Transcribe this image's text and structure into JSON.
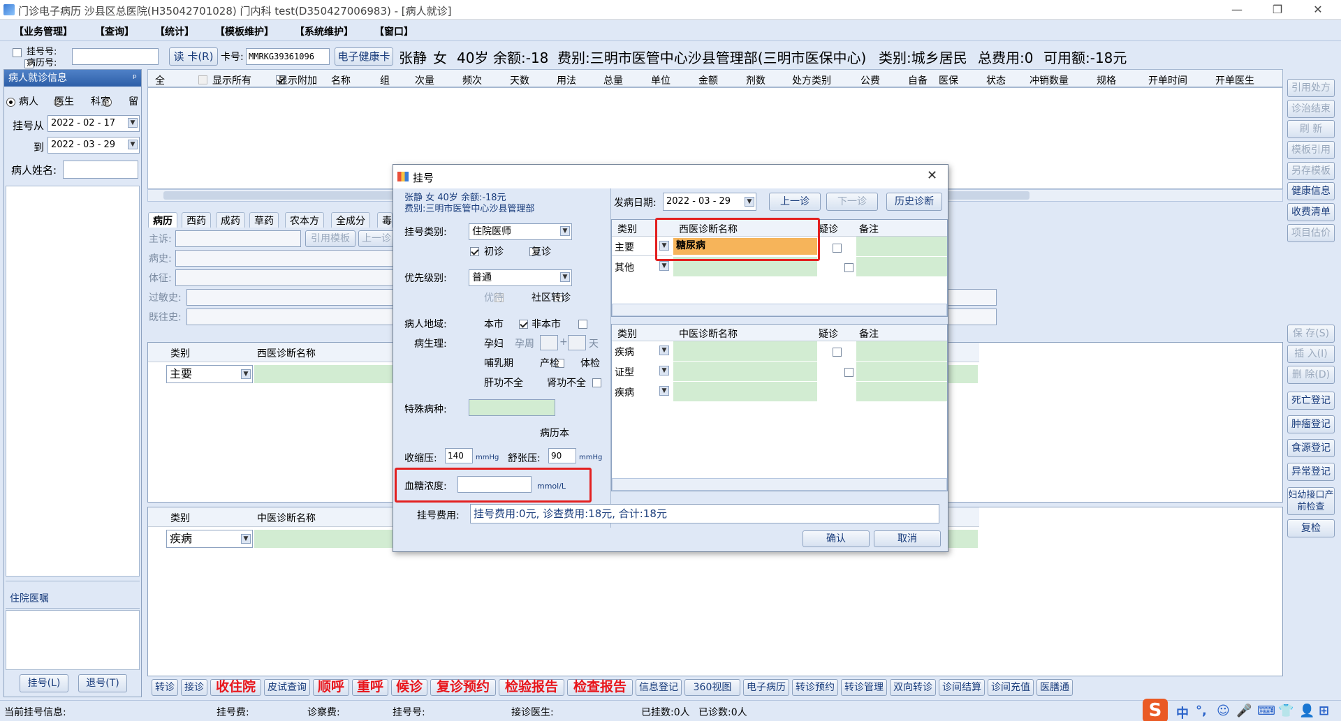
{
  "window": {
    "title": "门诊电子病历 沙县区总医院(H35042701028) 门内科 test(D350427006983) - [病人就诊]",
    "minimize": "—",
    "restore": "❐",
    "close": "✕"
  },
  "menu": [
    "【业务管理】",
    "【查询】",
    "【统计】",
    "【模板维护】",
    "【系统维护】",
    "【窗口】"
  ],
  "infobar": {
    "reg_no_label": "挂号号:",
    "record_no_label": "病历号:",
    "read_card": "读 卡(R)",
    "card_label": "卡号:",
    "card_value": "MMRKG39361096",
    "ehealth_card": "电子健康卡",
    "patient_name": "张静",
    "sex": "女",
    "age": "40岁",
    "balance": "余额:-18",
    "fee_type": "费别:三明市医管中心沙县管理部(三明市医保中心)",
    "category": "类别:城乡居民",
    "total_fee": "总费用:0",
    "available": "可用额:-18元"
  },
  "left": {
    "header": "病人就诊信息",
    "pin": "ᵖ",
    "radios": [
      "病人",
      "医生",
      "科室",
      "留"
    ],
    "from_label": "挂号从",
    "from_date": "2022 - 02 - 17",
    "to_label": "到",
    "to_date": "2022 - 03 - 29",
    "name_label": "病人姓名:",
    "inpatient_orders": "住院医嘱",
    "register_btn": "挂号(L)",
    "unregister_btn": "退号(T)"
  },
  "grid": {
    "all_label": "全",
    "show_all": "显示所有",
    "show_extra": "显示附加",
    "columns": [
      "名称",
      "组",
      "次量",
      "频次",
      "天数",
      "用法",
      "总量",
      "单位",
      "金额",
      "剂数",
      "处方类别",
      "公费",
      "自备",
      "医保",
      "状态",
      "冲销数量",
      "规格",
      "开单时间",
      "开单医生"
    ]
  },
  "tabs": [
    "病历",
    "西药",
    "成药",
    "草药",
    "农本方",
    "全成分",
    "毒"
  ],
  "emr": {
    "fields": [
      "主诉:",
      "病史:",
      "体征:",
      "过敏史:",
      "既往史:"
    ],
    "cite_template": "引用模板",
    "prev_visit": "上一诊",
    "western_header": {
      "type": "类别",
      "name": "西医诊断名称"
    },
    "western_row_type": "主要",
    "tcm_header": {
      "type": "类别",
      "name": "中医诊断名称"
    },
    "tcm_row_type": "疾病"
  },
  "right_buttons": [
    "引用处方",
    "诊治结束",
    "刷 新",
    "模板引用",
    "另存模板",
    "健康信息",
    "收费清单",
    "项目估价",
    "保 存(S)",
    "插 入(I)",
    "删 除(D)",
    "死亡登记",
    "肿瘤登记",
    "食源登记",
    "异常登记",
    "妇幼接口产前检查",
    "复检"
  ],
  "right_buttons_enabled": [
    false,
    false,
    false,
    false,
    false,
    true,
    true,
    false,
    false,
    false,
    false,
    true,
    true,
    true,
    true,
    true,
    true
  ],
  "bottom_buttons": [
    {
      "label": "转诊",
      "red": false
    },
    {
      "label": "接诊",
      "red": false
    },
    {
      "label": "收住院",
      "red": true
    },
    {
      "label": "皮试查询",
      "red": false
    },
    {
      "label": "顺呼",
      "red": true
    },
    {
      "label": "重呼",
      "red": true
    },
    {
      "label": "候诊",
      "red": true
    },
    {
      "label": "复诊预约",
      "red": true
    },
    {
      "label": "检验报告",
      "red": true
    },
    {
      "label": "检查报告",
      "red": true
    },
    {
      "label": "信息登记",
      "red": false
    },
    {
      "label": "360视图",
      "red": false
    },
    {
      "label": "电子病历",
      "red": false
    },
    {
      "label": "转诊预约",
      "red": false
    },
    {
      "label": "转诊管理",
      "red": false
    },
    {
      "label": "双向转诊",
      "red": false
    },
    {
      "label": "诊间结算",
      "red": false
    },
    {
      "label": "诊间充值",
      "red": false
    },
    {
      "label": "医膳通",
      "red": false
    }
  ],
  "status": {
    "current": "当前挂号信息:",
    "reg_fee": "挂号费:",
    "diag_fee": "诊察费:",
    "reg_no": "挂号号:",
    "doctor": "接诊医生:",
    "registered": "已挂数:0人",
    "seen": "已诊数:0人"
  },
  "ime": {
    "logo": "S",
    "items": [
      "中",
      "°,",
      "☺",
      "🎤",
      "⌨",
      "👕",
      "👤",
      "⊞"
    ]
  },
  "dialog": {
    "title": "挂号",
    "close": "✕",
    "patient_line1": "张静 女 40岁 余额:-18元",
    "patient_line2": "费别:三明市医管中心沙县管理部",
    "reg_type_label": "挂号类别:",
    "reg_type": "住院医师",
    "first_visit": "初诊",
    "revisit": "复诊",
    "priority_label": "优先级别:",
    "priority": "普通",
    "preferential": "优待",
    "community_transfer": "社区转诊",
    "region_label": "病人地域:",
    "local": "本市",
    "nonlocal": "非本市",
    "physio_label": "病生理:",
    "pregnant": "孕妇",
    "preg_weeks": "孕周",
    "plus": "+",
    "days": "天",
    "lactation": "哺乳期",
    "prenatal": "产检",
    "checkup": "体检",
    "liver": "肝功不全",
    "kidney": "肾功不全",
    "special_label": "特殊病种:",
    "record_book": "病历本",
    "systolic_label": "收缩压:",
    "systolic": "140",
    "diastolic_label": "舒张压:",
    "diastolic": "90",
    "mmhg": "mmHg",
    "glucose_label": "血糖浓度:",
    "glucose_unit": "mmol/L",
    "onset_label": "发病日期:",
    "onset_date": "2022 - 03 - 29",
    "prev_btn": "上一诊",
    "next_btn": "下一诊",
    "history_btn": "历史诊断",
    "western_cols": [
      "类别",
      "西医诊断名称",
      "疑诊",
      "备注"
    ],
    "western_rows": [
      {
        "type": "主要",
        "name": "糖尿病"
      },
      {
        "type": "其他",
        "name": ""
      }
    ],
    "tcm_cols": [
      "类别",
      "中医诊断名称",
      "疑诊",
      "备注"
    ],
    "tcm_rows": [
      {
        "type": "疾病"
      },
      {
        "type": "证型"
      },
      {
        "type": "疾病"
      }
    ],
    "fee_label": "挂号费用:",
    "fee_text": "挂号费用:0元, 诊查费用:18元, 合计:18元",
    "confirm": "确认",
    "cancel": "取消"
  }
}
